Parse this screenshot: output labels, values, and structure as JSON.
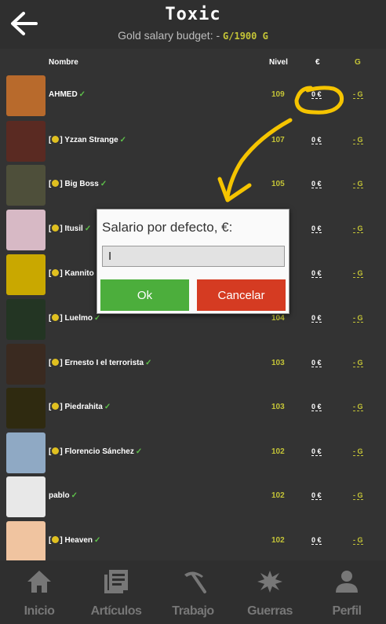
{
  "header": {
    "title": "Toxic",
    "subtitle_prefix": "Gold salary budget: - ",
    "subtitle_budget": "G/1900 G"
  },
  "columns": {
    "name": "Nombre",
    "level": "Nivel",
    "euro": "€",
    "gold": "G"
  },
  "players": [
    {
      "tag": "",
      "name": "AHMED",
      "level": "109",
      "euro": "0 €",
      "gold": "- G"
    },
    {
      "tag": "[",
      "tag_end": "]",
      "name": "Yzzan Strange",
      "level": "107",
      "euro": "0 €",
      "gold": "- G"
    },
    {
      "tag": "[",
      "tag_end": "]",
      "name": "Big Boss",
      "level": "105",
      "euro": "0 €",
      "gold": "- G"
    },
    {
      "tag": "[",
      "tag_end": "]",
      "name": "Itusil",
      "level": "",
      "euro": "0 €",
      "gold": "- G"
    },
    {
      "tag": "[",
      "tag_end": "]",
      "name": "Kannito",
      "level": "",
      "euro": "0 €",
      "gold": "- G"
    },
    {
      "tag": "[",
      "tag_end": "]",
      "name": "Luelmo",
      "level": "104",
      "euro": "0 €",
      "gold": "- G"
    },
    {
      "tag": "[",
      "tag_end": "]",
      "name": "Ernesto I el terrorista",
      "level": "103",
      "euro": "0 €",
      "gold": "- G"
    },
    {
      "tag": "[",
      "tag_end": "]",
      "name": "Piedrahita",
      "level": "103",
      "euro": "0 €",
      "gold": "- G"
    },
    {
      "tag": "[",
      "tag_end": "]",
      "name": "Florencio Sánchez",
      "level": "102",
      "euro": "0 €",
      "gold": "- G"
    },
    {
      "tag": "",
      "name": "pablo",
      "level": "102",
      "euro": "0 €",
      "gold": "- G"
    },
    {
      "tag": "[",
      "tag_end": "]",
      "name": "Heaven",
      "level": "102",
      "euro": "0 €",
      "gold": "- G"
    }
  ],
  "dialog": {
    "label": "Salario por defecto, €:",
    "input_value": "I",
    "ok_label": "Ok",
    "cancel_label": "Cancelar"
  },
  "nav": [
    {
      "label": "Inicio",
      "icon": "home-icon"
    },
    {
      "label": "Artículos",
      "icon": "articles-icon"
    },
    {
      "label": "Trabajo",
      "icon": "pickaxe-icon"
    },
    {
      "label": "Guerras",
      "icon": "explosion-icon"
    },
    {
      "label": "Perfil",
      "icon": "profile-icon"
    }
  ],
  "colors": {
    "gold": "#c4c437",
    "ok": "#4cae3c",
    "cancel": "#d53b22",
    "annotation": "#f5c400"
  }
}
